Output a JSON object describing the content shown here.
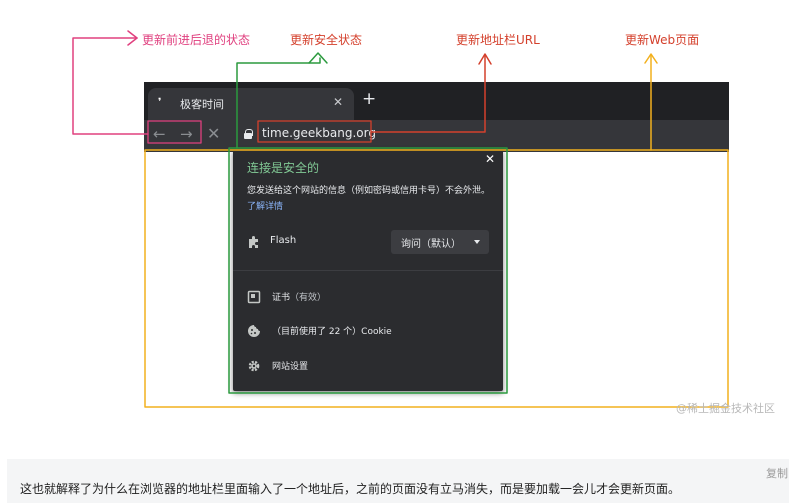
{
  "annotations": {
    "back_forward_state": "更新前进后退的状态",
    "security_state": "更新安全状态",
    "address_bar_url": "更新地址栏URL",
    "web_page": "更新Web页面"
  },
  "browser": {
    "tab_title": "极客时间",
    "tab_close": "✕",
    "new_tab": "+",
    "nav_back": "←",
    "nav_forward": "→",
    "nav_stop": "✕",
    "url": "time.geekbang.org"
  },
  "popup": {
    "close": "✕",
    "title": "连接是安全的",
    "desc_text": "您发送给这个网站的信息（例如密码或信用卡号）不会外泄。",
    "desc_link": "了解详情",
    "flash_label": "Flash",
    "flash_value": "询问（默认）",
    "cert_label": "证书",
    "cert_sub": "（有效）",
    "cookie_label": "（目前使用了 22 个）Cookie",
    "settings_label": "网站设置"
  },
  "watermark": "@稀土掘金技术社区",
  "copy_link": "复制",
  "caption": "这也就解释了为什么在浏览器的地址栏里面输入了一个地址后，之前的页面没有立马消失，而是要加载一会儿才会更新页面。",
  "colors": {
    "pink": "#e0407f",
    "green": "#2b9a3e",
    "red": "#d4402c",
    "yellow": "#f2b01e",
    "chrome_dark": "#202124",
    "popup_bg": "#2b2c2f",
    "secure_green": "#81c995",
    "link_blue": "#8ab4f8"
  }
}
